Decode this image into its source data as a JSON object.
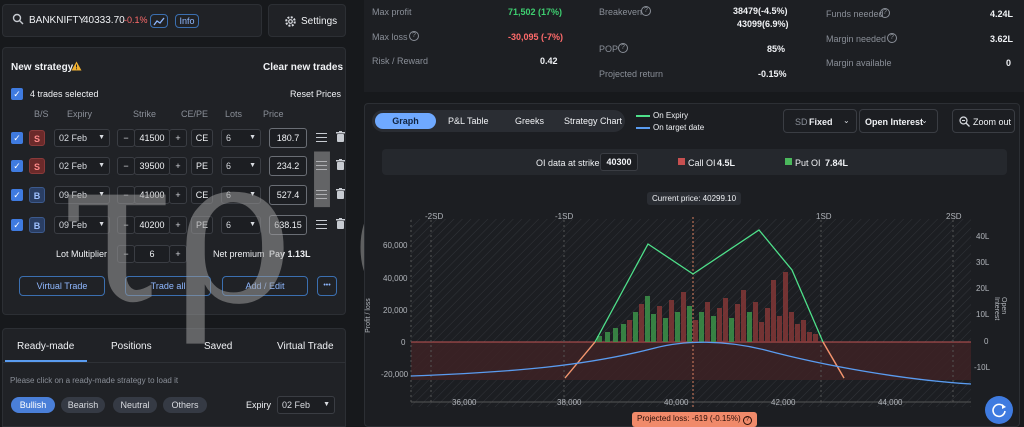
{
  "header": {
    "symbol": "BANKNIFTY",
    "price": "40333.70",
    "change": "-0.1%",
    "info_label": "Info",
    "settings_label": "Settings"
  },
  "strategy": {
    "title": "New strategy",
    "clear_label": "Clear new trades",
    "selected_label": "4 trades selected",
    "reset_label": "Reset Prices",
    "columns": [
      "B/S",
      "Expiry",
      "Strike",
      "CE/PE",
      "Lots",
      "Price"
    ],
    "legs": [
      {
        "side": "S",
        "expiry": "02 Feb",
        "strike": "41500",
        "type": "CE",
        "lots": "6",
        "price": "180.7"
      },
      {
        "side": "S",
        "expiry": "02 Feb",
        "strike": "39500",
        "type": "PE",
        "lots": "6",
        "price": "234.2"
      },
      {
        "side": "B",
        "expiry": "09 Feb",
        "strike": "41000",
        "type": "CE",
        "lots": "6",
        "price": "527.4"
      },
      {
        "side": "B",
        "expiry": "09 Feb",
        "strike": "40200",
        "type": "PE",
        "lots": "6",
        "price": "638.15"
      }
    ],
    "lot_multiplier_label": "Lot Multiplier",
    "lot_multiplier_value": "6",
    "net_premium_label": "Net premium",
    "net_premium_value": "Pay 1.13L",
    "virtual_trade_label": "Virtual Trade",
    "trade_all_label": "Trade all",
    "add_edit_label": "Add / Edit",
    "more_label": "•••"
  },
  "bottom_tabs": {
    "tabs": [
      "Ready-made",
      "Positions",
      "Saved",
      "Virtual Trade"
    ],
    "hint": "Please click on a ready-made strategy to load it",
    "filters": [
      "Bullish",
      "Bearish",
      "Neutral",
      "Others"
    ],
    "expiry_label": "Expiry",
    "expiry_value": "02 Feb"
  },
  "stats": {
    "max_profit_label": "Max profit",
    "max_profit_value": "71,502 (17%)",
    "max_loss_label": "Max loss",
    "max_loss_value": "-30,095 (-7%)",
    "risk_reward_label": "Risk / Reward",
    "risk_reward_value": "0.42",
    "breakeven_label": "Breakeven",
    "breakeven_value_1": "38479(-4.5%)",
    "breakeven_value_2": "43099(6.9%)",
    "pop_label": "POP",
    "pop_value": "85%",
    "projected_return_label": "Projected return",
    "projected_return_value": "-0.15%",
    "funds_needed_label": "Funds needed",
    "funds_needed_value": "4.24L",
    "margin_needed_label": "Margin needed",
    "margin_needed_value": "3.62L",
    "margin_available_label": "Margin available",
    "margin_available_value": "0"
  },
  "graph": {
    "tabs": [
      "Graph",
      "P&L Table",
      "Greeks",
      "Strategy Chart"
    ],
    "legend_expiry": "On Expiry",
    "legend_target": "On target date",
    "sd_label": "SD",
    "sd_value": "Fixed",
    "oi_select": "Open Interest",
    "zoom_label": "Zoom out",
    "oi_strike_label": "OI data at strike",
    "oi_strike_value": "40300",
    "call_oi_label": "Call OI",
    "call_oi_value": "4.5L",
    "put_oi_label": "Put OI",
    "put_oi_value": "7.84L",
    "current_price_label": "Current price: 40299.10",
    "projected_loss_label": "Projected loss: -619 (-0.15%)",
    "y_axis_title": "Profit / loss",
    "y2_axis_title": "Open Interest",
    "sd_marks": [
      "-2SD",
      "-1SD",
      "1SD",
      "2SD"
    ],
    "y_ticks": [
      "60,000",
      "40,000",
      "20,000",
      "0",
      "-20,000"
    ],
    "y2_ticks": [
      "40L",
      "30L",
      "20L",
      "10L",
      "0",
      "-10L"
    ],
    "x_ticks": [
      "36,000",
      "38,000",
      "40,000",
      "42,000",
      "44,000"
    ]
  },
  "watermark": "τρ'αδεPik",
  "colors": {
    "accent": "#3f7be0",
    "profit": "#3ecf70",
    "loss": "#ff6b6b",
    "expiry_line": "#4ee08a",
    "target_line": "#5a9cf0"
  }
}
